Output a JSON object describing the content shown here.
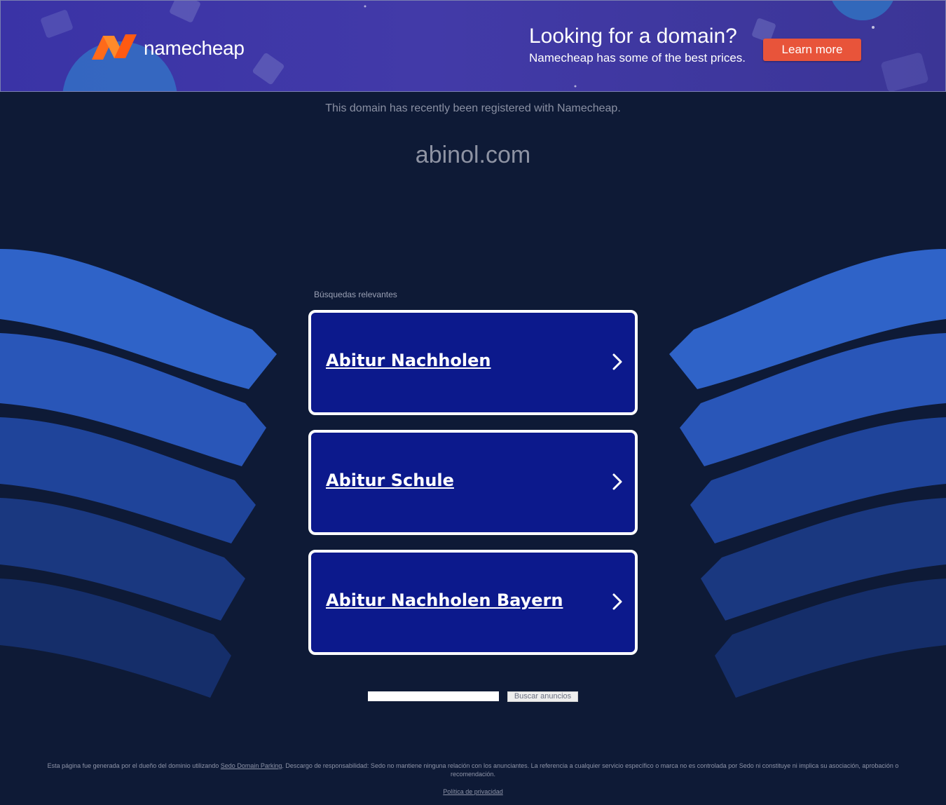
{
  "banner": {
    "logo_text": "namecheap",
    "promo_title": "Looking for a domain?",
    "promo_subtitle": "Namecheap has some of the best prices.",
    "cta_label": "Learn more"
  },
  "main": {
    "registered_note": "This domain has recently been registered with Namecheap.",
    "domain": "abinol.com",
    "related_heading": "Búsquedas relevantes",
    "results": [
      {
        "label": "Abitur Nachholen"
      },
      {
        "label": "Abitur Schule"
      },
      {
        "label": "Abitur Nachholen Bayern"
      }
    ]
  },
  "search": {
    "button_label": "Buscar anuncios"
  },
  "footer": {
    "disclaimer_pre": "Esta página fue generada por el dueño del dominio utilizando ",
    "disclaimer_link": "Sedo Domain Parking",
    "disclaimer_post": ". Descargo de responsabilidad: Sedo no mantiene ninguna relación con los anunciantes. La referencia a cualquier servicio específico o marca no es controlada por Sedo ni constituye ni implica su asociación, aprobación o recomendación.",
    "privacy_label": "Política de privacidad"
  },
  "colors": {
    "background": "#0e1a36",
    "banner": "#3f38a6",
    "cta": "#e8543a",
    "card": "#0c198c",
    "logo_orange": "#ff6a1a"
  }
}
